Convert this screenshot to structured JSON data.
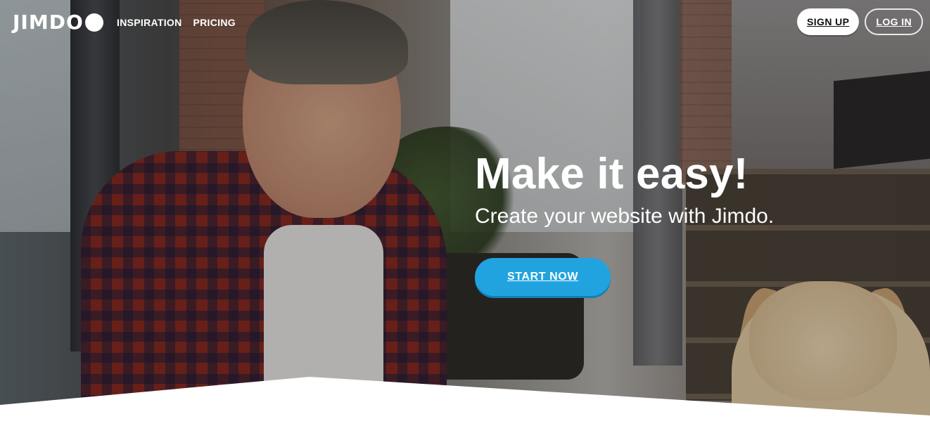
{
  "brand": {
    "logo_text": "JIMDO"
  },
  "nav": {
    "items": [
      "INSPIRATION",
      "PRICING"
    ]
  },
  "auth": {
    "signup": "SIGN UP",
    "login": "LOG IN"
  },
  "hero": {
    "headline": "Make it easy!",
    "subheadline": "Create your website with Jimdo.",
    "cta": "START NOW",
    "image": "hero-photo"
  },
  "colors": {
    "accent": "#21a3e0",
    "text_on_image": "#ffffff",
    "background_bottom": "#ffffff"
  }
}
